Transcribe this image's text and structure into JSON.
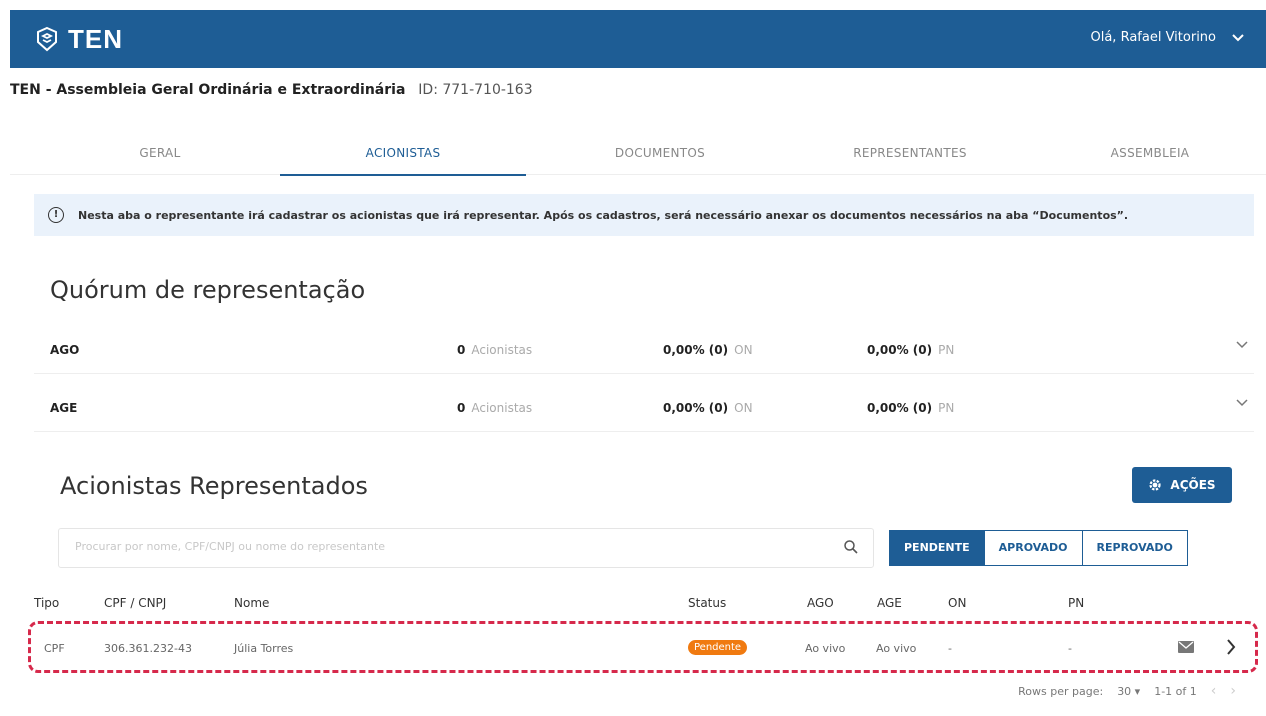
{
  "header": {
    "logo_text": "TEN",
    "user_greeting": "Olá, Rafael Vitorino"
  },
  "event": {
    "title": "TEN - Assembleia Geral Ordinária e Extraordinária",
    "id": "ID: 771-710-163"
  },
  "tabs": [
    {
      "label": "GERAL"
    },
    {
      "label": "ACIONISTAS"
    },
    {
      "label": "DOCUMENTOS"
    },
    {
      "label": "REPRESENTANTES"
    },
    {
      "label": "ASSEMBLEIA"
    }
  ],
  "info_text": "Nesta aba o representante irá cadastrar os acionistas que irá representar. Após os cadastros, será necessário anexar os documentos necessários na aba “Documentos”.",
  "quorum": {
    "title": "Quórum de representação",
    "rows": [
      {
        "label": "AGO",
        "count": "0",
        "count_unit": "Acionistas",
        "on_value": "0,00% (0)",
        "on_unit": "ON",
        "pn_value": "0,00% (0)",
        "pn_unit": "PN"
      },
      {
        "label": "AGE",
        "count": "0",
        "count_unit": "Acionistas",
        "on_value": "0,00% (0)",
        "on_unit": "ON",
        "pn_value": "0,00% (0)",
        "pn_unit": "PN"
      }
    ]
  },
  "represented": {
    "title": "Acionistas Representados",
    "actions_label": "AÇÕES",
    "search_placeholder": "Procurar por nome, CPF/CNPJ ou nome do representante",
    "filters": [
      "PENDENTE",
      "APROVADO",
      "REPROVADO"
    ],
    "columns": [
      "Tipo",
      "CPF / CNPJ",
      "Nome",
      "Status",
      "AGO",
      "AGE",
      "ON",
      "PN"
    ],
    "rows": [
      {
        "tipo": "CPF",
        "doc": "306.361.232-43",
        "nome": "Júlia Torres",
        "status": "Pendente",
        "ago": "Ao vivo",
        "age": "Ao vivo",
        "on": "-",
        "pn": "-"
      }
    ]
  },
  "pagination": {
    "rows_per_page_label": "Rows per page:",
    "rows_per_page_value": "30",
    "range": "1-1 of 1"
  },
  "colors": {
    "primary": "#1e5d95",
    "status_pending": "#f07a10",
    "highlight": "#d6294b",
    "info_bg": "#eaf2fb"
  }
}
